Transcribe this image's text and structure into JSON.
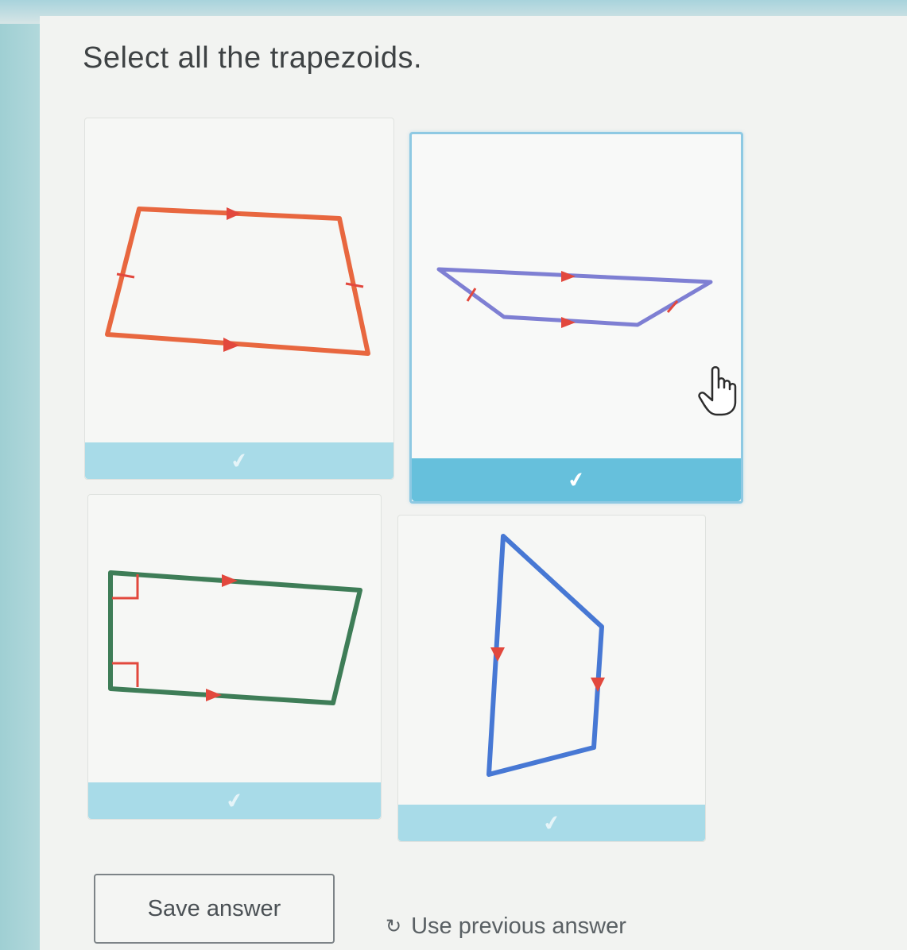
{
  "question": {
    "text": "Select all the trapezoids."
  },
  "choices": [
    {
      "label": "choice-1",
      "shape": "trapezoid",
      "color": "#e8673f",
      "selected": false
    },
    {
      "label": "choice-2",
      "shape": "trapezoid",
      "color": "#7e7fd3",
      "selected": false,
      "hovered": true
    },
    {
      "label": "choice-3",
      "shape": "right-trapezoid",
      "color": "#3e7d57",
      "selected": false
    },
    {
      "label": "choice-4",
      "shape": "trapezoid",
      "color": "#4778d4",
      "selected": false
    }
  ],
  "icons": {
    "check": "✔",
    "undo": "↻",
    "cursor": "hand-cursor-icon"
  },
  "colors": {
    "mark": "#e2483d",
    "check_bar": "#a8dbe8",
    "check_bar_active": "#66c0dc",
    "accent_border": "#8ec9e3"
  },
  "actions": {
    "save_label": "Save answer",
    "use_previous_label": "Use previous answer"
  }
}
